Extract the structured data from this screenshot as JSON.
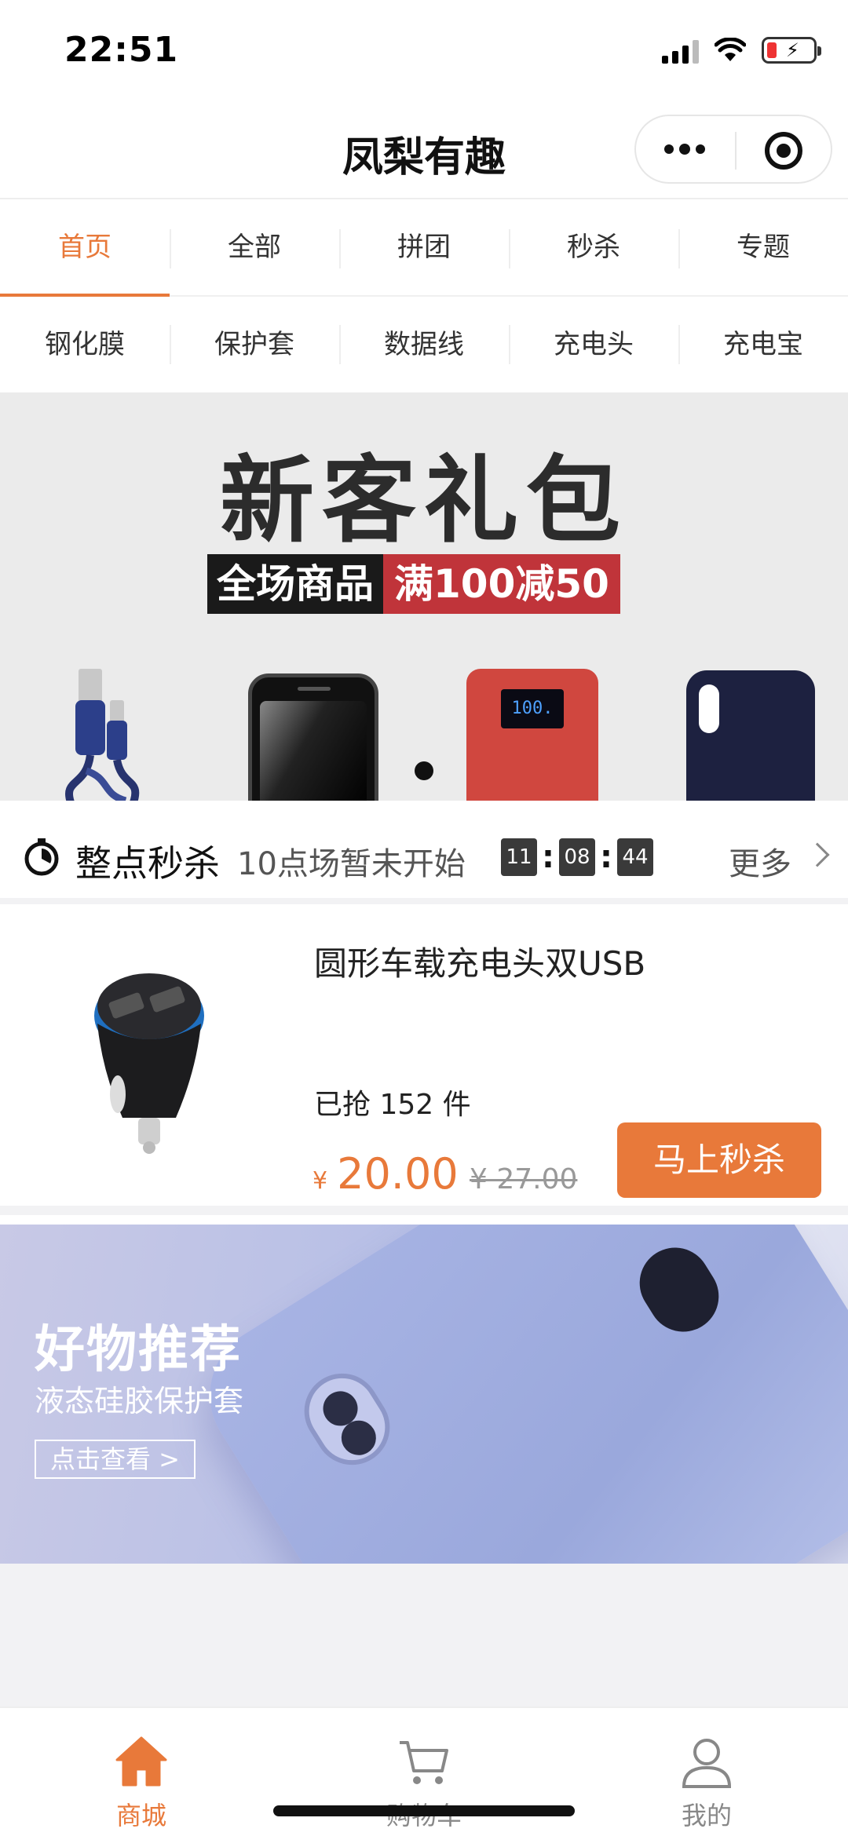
{
  "status_bar": {
    "time": "22:51"
  },
  "header": {
    "title": "凤梨有趣"
  },
  "tabs": [
    {
      "label": "首页",
      "active": true
    },
    {
      "label": "全部"
    },
    {
      "label": "拼团"
    },
    {
      "label": "秒杀"
    },
    {
      "label": "专题"
    }
  ],
  "categories": [
    "钢化膜",
    "保护套",
    "数据线",
    "充电头",
    "充电宝"
  ],
  "hero_banner": {
    "title": "新客礼包",
    "promo_left": "全场商品",
    "promo_right": "满100减50",
    "powerbank_display": "100."
  },
  "flash_sale": {
    "title": "整点秒杀",
    "subtitle": "10点场暂未开始",
    "countdown": [
      "11",
      "08",
      "44"
    ],
    "more_label": "更多"
  },
  "product": {
    "name": "圆形车载充电头双USB",
    "sold": "已抢 152 件",
    "currency": "¥",
    "price": "20.00",
    "original_price": "¥ 27.00",
    "buy_label": "马上秒杀"
  },
  "recommend_banner": {
    "title": "好物推荐",
    "subtitle": "液态硅胶保护套",
    "button_label": "点击查看 >"
  },
  "tab_bar": [
    {
      "label": "商城",
      "icon": "home-icon",
      "active": true
    },
    {
      "label": "购物车",
      "icon": "cart-icon"
    },
    {
      "label": "我的",
      "icon": "user-icon"
    }
  ],
  "colors": {
    "accent": "#e8793a",
    "promo_red": "#c0343a"
  }
}
